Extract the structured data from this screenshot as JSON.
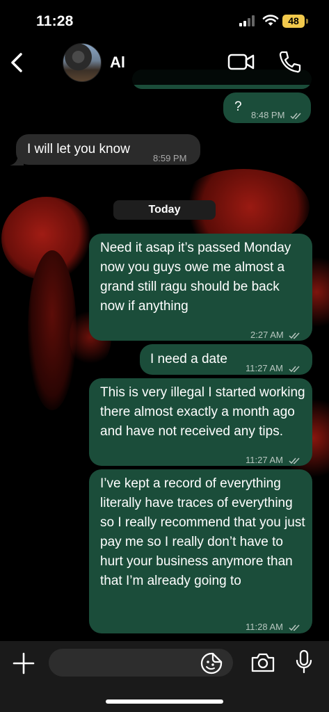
{
  "status_bar": {
    "time": "11:28",
    "battery": "48"
  },
  "header": {
    "contact_name": "Al"
  },
  "messages": [
    {
      "direction": "out",
      "text": "?",
      "time": "8:48 PM",
      "status": "read"
    },
    {
      "direction": "in",
      "text": "I will let you know",
      "time": "8:59 PM"
    },
    {
      "direction": "out",
      "text": "Need it asap it’s passed Monday now you guys owe me almost a grand still ragu should be back now if anything",
      "time": "2:27 AM",
      "status": "read"
    },
    {
      "direction": "out",
      "text": "I need a date",
      "time": "11:27 AM",
      "status": "read"
    },
    {
      "direction": "out",
      "text": "This is very illegal I started working there almost exactly a month ago and have not received any tips.",
      "time": "11:27 AM",
      "status": "read"
    },
    {
      "direction": "out",
      "text": "I’ve kept a record of everything literally have traces of everything so I really recommend that you just pay me so I really don’t have to hurt your business anymore than that I’m already going to",
      "time": "11:28 AM",
      "status": "read"
    }
  ],
  "date_separator": "Today",
  "composer": {
    "placeholder": ""
  },
  "colors": {
    "outgoing_bubble": "#1b4d3a",
    "incoming_bubble": "#2b2b2b",
    "background": "#000000",
    "battery": "#f2c94c"
  },
  "icons": [
    "back-chevron-icon",
    "video-call-icon",
    "phone-call-icon",
    "plus-icon",
    "sticker-icon",
    "camera-icon",
    "microphone-icon",
    "double-check-icon"
  ]
}
